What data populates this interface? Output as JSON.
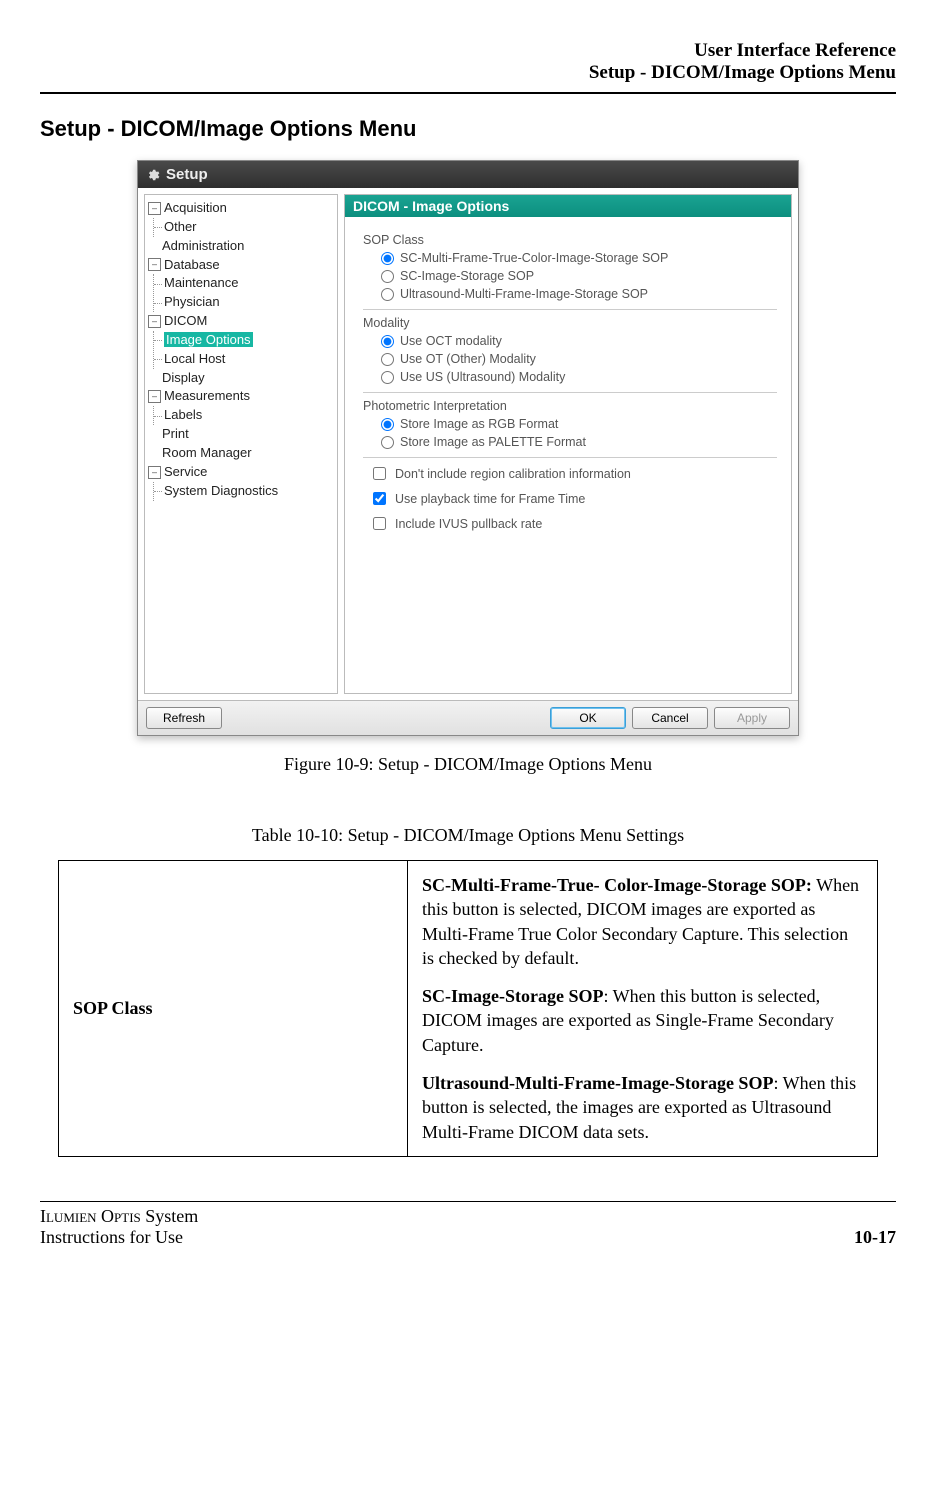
{
  "header": {
    "line1": "User Interface Reference",
    "line2": "Setup - DICOM/Image Options Menu"
  },
  "section_title": "Setup - DICOM/Image Options Menu",
  "dialog": {
    "title": "Setup",
    "tree": {
      "acquisition": "Acquisition",
      "other": "Other",
      "administration": "Administration",
      "database": "Database",
      "maintenance": "Maintenance",
      "physician": "Physician",
      "dicom": "DICOM",
      "image_options": "Image Options",
      "local_host": "Local Host",
      "display": "Display",
      "measurements": "Measurements",
      "labels": "Labels",
      "print": "Print",
      "room_manager": "Room Manager",
      "service": "Service",
      "system_diagnostics": "System Diagnostics"
    },
    "pane_title": "DICOM - Image Options",
    "groups": {
      "sop": "SOP Class",
      "modality": "Modality",
      "photo": "Photometric Interpretation"
    },
    "options": {
      "sop1": "SC-Multi-Frame-True-Color-Image-Storage SOP",
      "sop2": "SC-Image-Storage SOP",
      "sop3": "Ultrasound-Multi-Frame-Image-Storage SOP",
      "mod1": "Use OCT modality",
      "mod2": "Use OT (Other) Modality",
      "mod3": "Use US (Ultrasound) Modality",
      "ph1": "Store Image as RGB Format",
      "ph2": "Store Image as PALETTE Format",
      "chk1": "Don't include region calibration information",
      "chk2": "Use playback time for Frame Time",
      "chk3": "Include IVUS pullback rate"
    },
    "buttons": {
      "refresh": "Refresh",
      "ok": "OK",
      "cancel": "Cancel",
      "apply": "Apply"
    }
  },
  "figure_caption": "Figure 10-9:  Setup - DICOM/Image Options Menu",
  "table_caption": "Table 10-10:  Setup - DICOM/Image Options Menu Settings",
  "table": {
    "row1_key": "SOP Class",
    "row1_desc_p1_b": "SC-Multi-Frame-True- Color-Image-Storage SOP:",
    "row1_desc_p1_t": " When this button is selected, DICOM images are exported as Multi-Frame True Color Secondary Capture. This selection is checked by default.",
    "row1_desc_p2_b": "SC-Image-Storage SOP",
    "row1_desc_p2_t": ": When this button is selected, DICOM images are exported as Single-Frame Secondary Capture.",
    "row1_desc_p3_b": "Ultrasound-Multi-Frame-Image-Storage SOP",
    "row1_desc_p3_t": ": When this button is selected, the images are exported as Ultrasound Multi-Frame DICOM data sets."
  },
  "footer": {
    "product1": "Ilumien Optis",
    "product2": " System",
    "line2": "Instructions for Use",
    "page": "10-17"
  }
}
